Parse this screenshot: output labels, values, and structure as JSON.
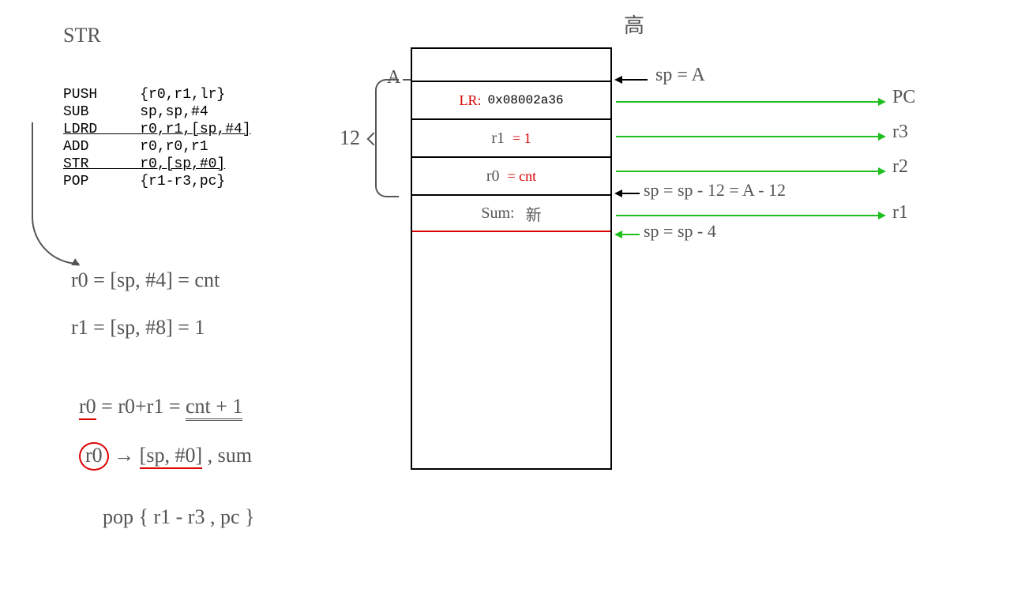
{
  "title_hand": "STR",
  "top_hand": "高",
  "asm": {
    "l1": "PUSH     {r0,r1,lr}",
    "l2": "SUB      sp,sp,#4",
    "l3": "LDRD     r0,r1,[sp,#4]",
    "l4": "ADD      r0,r0,r1",
    "l5": "STR      r0,[sp,#0]",
    "l6": "POP      {r1-r3,pc}"
  },
  "brace_label": "12",
  "a_label": "A",
  "stack": {
    "lr_lbl": "LR:",
    "lr_val": "0x08002a36",
    "r1_lbl": "r1",
    "r1_val": "= 1",
    "r0_lbl": "r0",
    "r0_val": "= cnt",
    "sum_lbl": "Sum:",
    "sum_val": "新"
  },
  "right": {
    "sp_a": "sp = A",
    "pc": "PC",
    "r3": "r3",
    "r2": "r2",
    "sp12": "sp = sp - 12 = A - 12",
    "r1": "r1",
    "sp4": "sp = sp - 4"
  },
  "notes": {
    "n1a": "r0 = [sp, #4] =",
    "n1b": "cnt",
    "n2": "r1 = [sp, #8] = 1",
    "n3a": "r0",
    "n3b": " = r0+r1 = ",
    "n3c": "cnt + 1",
    "n4a": "r0",
    "n4b": " → ",
    "n4c": "[sp, #0]",
    "n4d": " , sum",
    "n5": "pop  { r1 - r3 , pc }"
  }
}
